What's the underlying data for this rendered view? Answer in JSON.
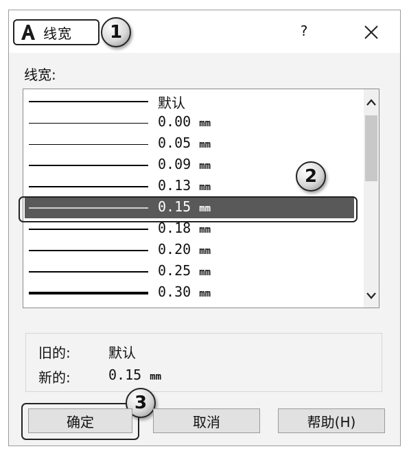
{
  "dialog": {
    "title": "线宽",
    "help_label": "?",
    "field_label": "线宽:",
    "callouts": [
      "1",
      "2",
      "3"
    ]
  },
  "lineweights": [
    {
      "label": "默认",
      "unit": ""
    },
    {
      "label": "0.00 ",
      "unit": "mm"
    },
    {
      "label": "0.05 ",
      "unit": "mm"
    },
    {
      "label": "0.09 ",
      "unit": "mm"
    },
    {
      "label": "0.13 ",
      "unit": "mm"
    },
    {
      "label": "0.15 ",
      "unit": "mm",
      "selected": true
    },
    {
      "label": "0.18 ",
      "unit": "mm"
    },
    {
      "label": "0.20 ",
      "unit": "mm"
    },
    {
      "label": "0.25 ",
      "unit": "mm"
    },
    {
      "label": "0.30 ",
      "unit": "mm"
    }
  ],
  "info": {
    "old_label": "旧的:",
    "old_value": "默认",
    "new_label": "新的:",
    "new_value": "0.15 ",
    "new_unit": "mm"
  },
  "buttons": {
    "ok": "确定",
    "cancel": "取消",
    "help": "帮助(H)"
  },
  "colors": {
    "selection": "#595959",
    "dialog_bg": "#f3f3f3"
  }
}
